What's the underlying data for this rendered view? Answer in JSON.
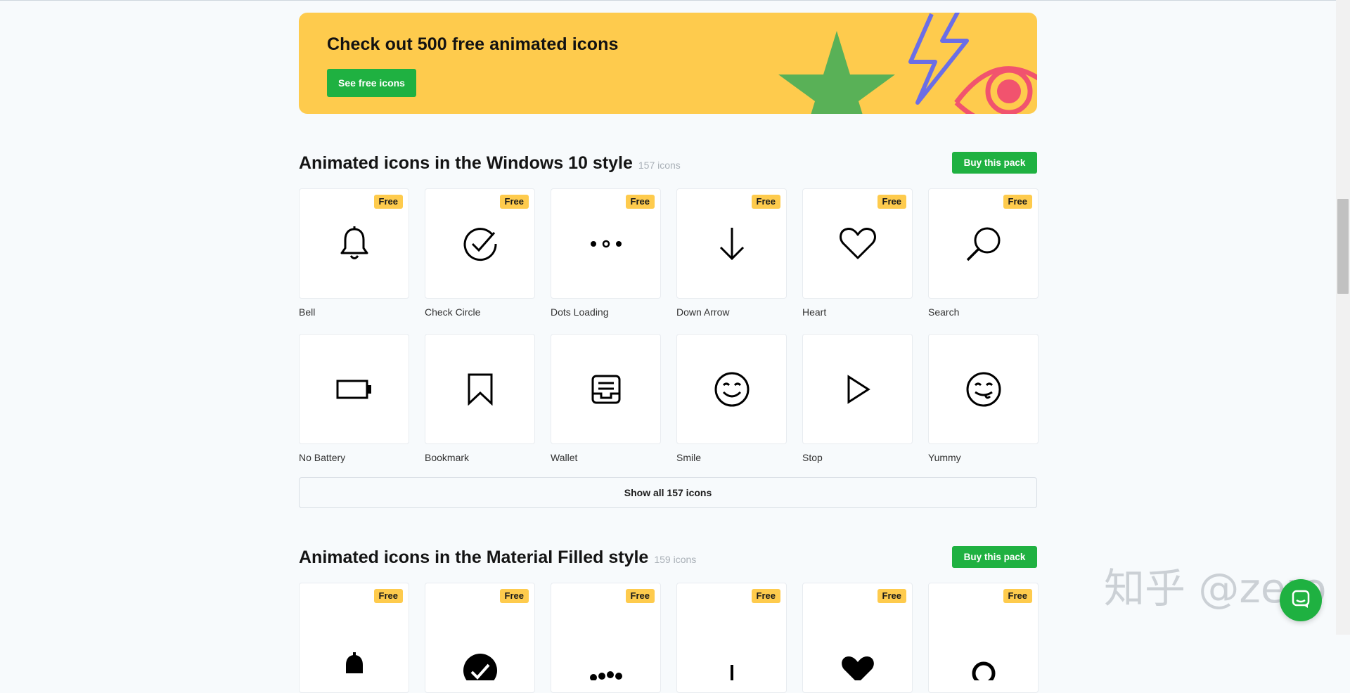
{
  "banner": {
    "title": "Check out 500 free animated icons",
    "button_label": "See free icons",
    "colors": {
      "background": "#fecb4d",
      "star": "#59b157",
      "bolt": "#6b6ee6",
      "eye": "#f1536e"
    }
  },
  "sections": [
    {
      "title": "Animated icons in the Windows 10 style",
      "count": "157 icons",
      "buy_label": "Buy this pack",
      "badge": "Free",
      "show_all_label": "Show all 157 icons",
      "icons_row1": [
        {
          "name": "Bell",
          "icon": "bell-icon",
          "free": true
        },
        {
          "name": "Check Circle",
          "icon": "check-circle-icon",
          "free": true
        },
        {
          "name": "Dots Loading",
          "icon": "dots-loading-icon",
          "free": true
        },
        {
          "name": "Down Arrow",
          "icon": "down-arrow-icon",
          "free": true
        },
        {
          "name": "Heart",
          "icon": "heart-icon",
          "free": true
        },
        {
          "name": "Search",
          "icon": "search-icon",
          "free": true
        }
      ],
      "icons_row2": [
        {
          "name": "No Battery",
          "icon": "no-battery-icon",
          "free": false
        },
        {
          "name": "Bookmark",
          "icon": "bookmark-icon",
          "free": false
        },
        {
          "name": "Wallet",
          "icon": "wallet-icon",
          "free": false
        },
        {
          "name": "Smile",
          "icon": "smile-icon",
          "free": false
        },
        {
          "name": "Stop",
          "icon": "stop-icon",
          "free": false
        },
        {
          "name": "Yummy",
          "icon": "yummy-icon",
          "free": false
        }
      ]
    },
    {
      "title": "Animated icons in the Material Filled style",
      "count": "159 icons",
      "buy_label": "Buy this pack",
      "badge": "Free"
    }
  ],
  "watermark": "知乎 @zero",
  "colors": {
    "accent_green": "#1fb141",
    "badge_yellow": "#fecb4d",
    "page_bg": "#f7fafc"
  }
}
